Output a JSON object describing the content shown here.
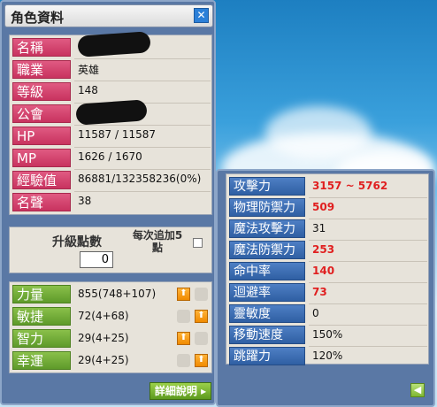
{
  "window_title": "角色資料",
  "close_icon": "close-icon",
  "info": [
    {
      "label": "名稱",
      "value": "",
      "redacted": true
    },
    {
      "label": "職業",
      "value": "英雄"
    },
    {
      "label": "等級",
      "value": "148"
    },
    {
      "label": "公會",
      "value": "",
      "redacted": true
    },
    {
      "label": "HP",
      "value": "11587 / 11587"
    },
    {
      "label": "MP",
      "value": "1626 / 1670"
    },
    {
      "label": "經驗值",
      "value": "86881/132358236(0%)"
    },
    {
      "label": "名聲",
      "value": "38"
    }
  ],
  "ap": {
    "title": "升級點數",
    "value": "0",
    "auto_label_1": "每次追加5",
    "auto_label_2": "點"
  },
  "attributes": [
    {
      "label": "力量",
      "value": "855(748+107)"
    },
    {
      "label": "敏捷",
      "value": "72(4+68)"
    },
    {
      "label": "智力",
      "value": "29(4+25)"
    },
    {
      "label": "幸運",
      "value": "29(4+25)"
    }
  ],
  "detail_button": "詳細說明",
  "details": [
    {
      "label": "攻擊力",
      "value": "3157 ~ 5762",
      "color": "#e02020"
    },
    {
      "label": "物理防禦力",
      "value": "509",
      "color": "#e02020"
    },
    {
      "label": "魔法攻擊力",
      "value": "31",
      "color": "#111111"
    },
    {
      "label": "魔法防禦力",
      "value": "253",
      "color": "#e02020"
    },
    {
      "label": "命中率",
      "value": "140",
      "color": "#e02020"
    },
    {
      "label": "迴避率",
      "value": "73",
      "color": "#e02020"
    },
    {
      "label": "靈敏度",
      "value": "0",
      "color": "#111111"
    },
    {
      "label": "移動速度",
      "value": "150%",
      "color": "#111111"
    },
    {
      "label": "跳躍力",
      "value": "120%",
      "color": "#111111"
    }
  ],
  "colors": {
    "label_pink": "#d2436c",
    "label_green": "#6fa835",
    "label_blue": "#3d6db2",
    "value_red": "#e02020"
  }
}
